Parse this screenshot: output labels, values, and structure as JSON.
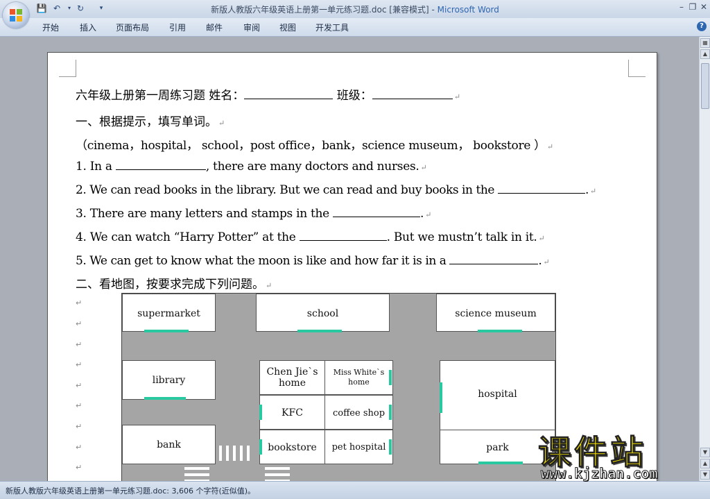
{
  "window": {
    "title": "新版人教版六年级英语上册第一单元练习题.doc [兼容模式]",
    "app_name": "Microsoft Word",
    "separator": " - "
  },
  "ribbon_tabs": [
    "开始",
    "插入",
    "页面布局",
    "引用",
    "邮件",
    "审阅",
    "视图",
    "开发工具"
  ],
  "document": {
    "line1": "六年级上册第一周练习题   姓名：",
    "line1_class": " 班级：",
    "line2": "一、根据提示，填写单词。",
    "line3": "（cinema，hospital，  school，post office，bank，science museum，   bookstore ）",
    "q1_a": "1. In a ",
    "q1_b": ", there are many doctors and nurses.",
    "q2_a": "2. We can read books in the library. But we can read and buy books in the ",
    "q2_b": ".",
    "q3_a": "3. There are many letters and stamps in the ",
    "q3_b": ".",
    "q4_a": "4. We can watch “Harry Potter” at the ",
    "q4_b": ". But we mustn’t talk in it.",
    "q5_a": "5. We can get to know what the moon is like and how far it is in a ",
    "q5_b": ".",
    "section2": "二、看地图，按要求完成下列问题。",
    "return_mark": "↵"
  },
  "map": {
    "supermarket": "supermarket",
    "school": "school",
    "science_museum": "science museum",
    "library": "library",
    "chen_jie_home": "Chen Jie`s home",
    "miss_white_home": "Miss White`s home",
    "hospital": "hospital",
    "kfc": "KFC",
    "coffee_shop": "coffee shop",
    "bank": "bank",
    "bookstore": "bookstore",
    "pet_hospital": "pet hospital",
    "park": "park",
    "door_color": "#28c9a0"
  },
  "status": {
    "text": "新版人教版六年级英语上册第一单元练习题.doc: 3,606 个字符(近似值)。"
  },
  "watermark": {
    "cn": "课件站",
    "url": "www.kjzhan.com"
  }
}
